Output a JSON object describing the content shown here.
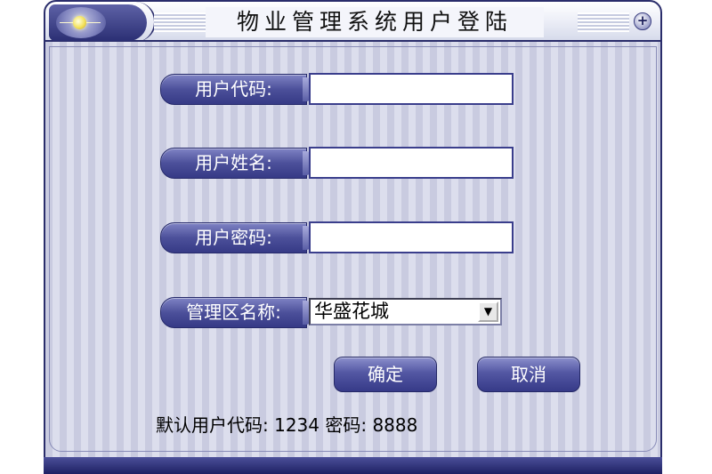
{
  "window": {
    "title": "物业管理系统用户登陆"
  },
  "form": {
    "user_code_label": "用户代码:",
    "user_code_value": "",
    "user_name_label": "用户姓名:",
    "user_name_value": "",
    "password_label": "用户密码:",
    "password_value": "",
    "district_label": "管理区名称:",
    "district_selected": "华盛花城"
  },
  "buttons": {
    "confirm": "确定",
    "cancel": "取消"
  },
  "hint": "默认用户代码: 1234 密码: 8888",
  "icons": {
    "app_icon": "sun-orb-icon",
    "expand": "plus-circle-icon",
    "dropdown": "chevron-down-icon"
  }
}
